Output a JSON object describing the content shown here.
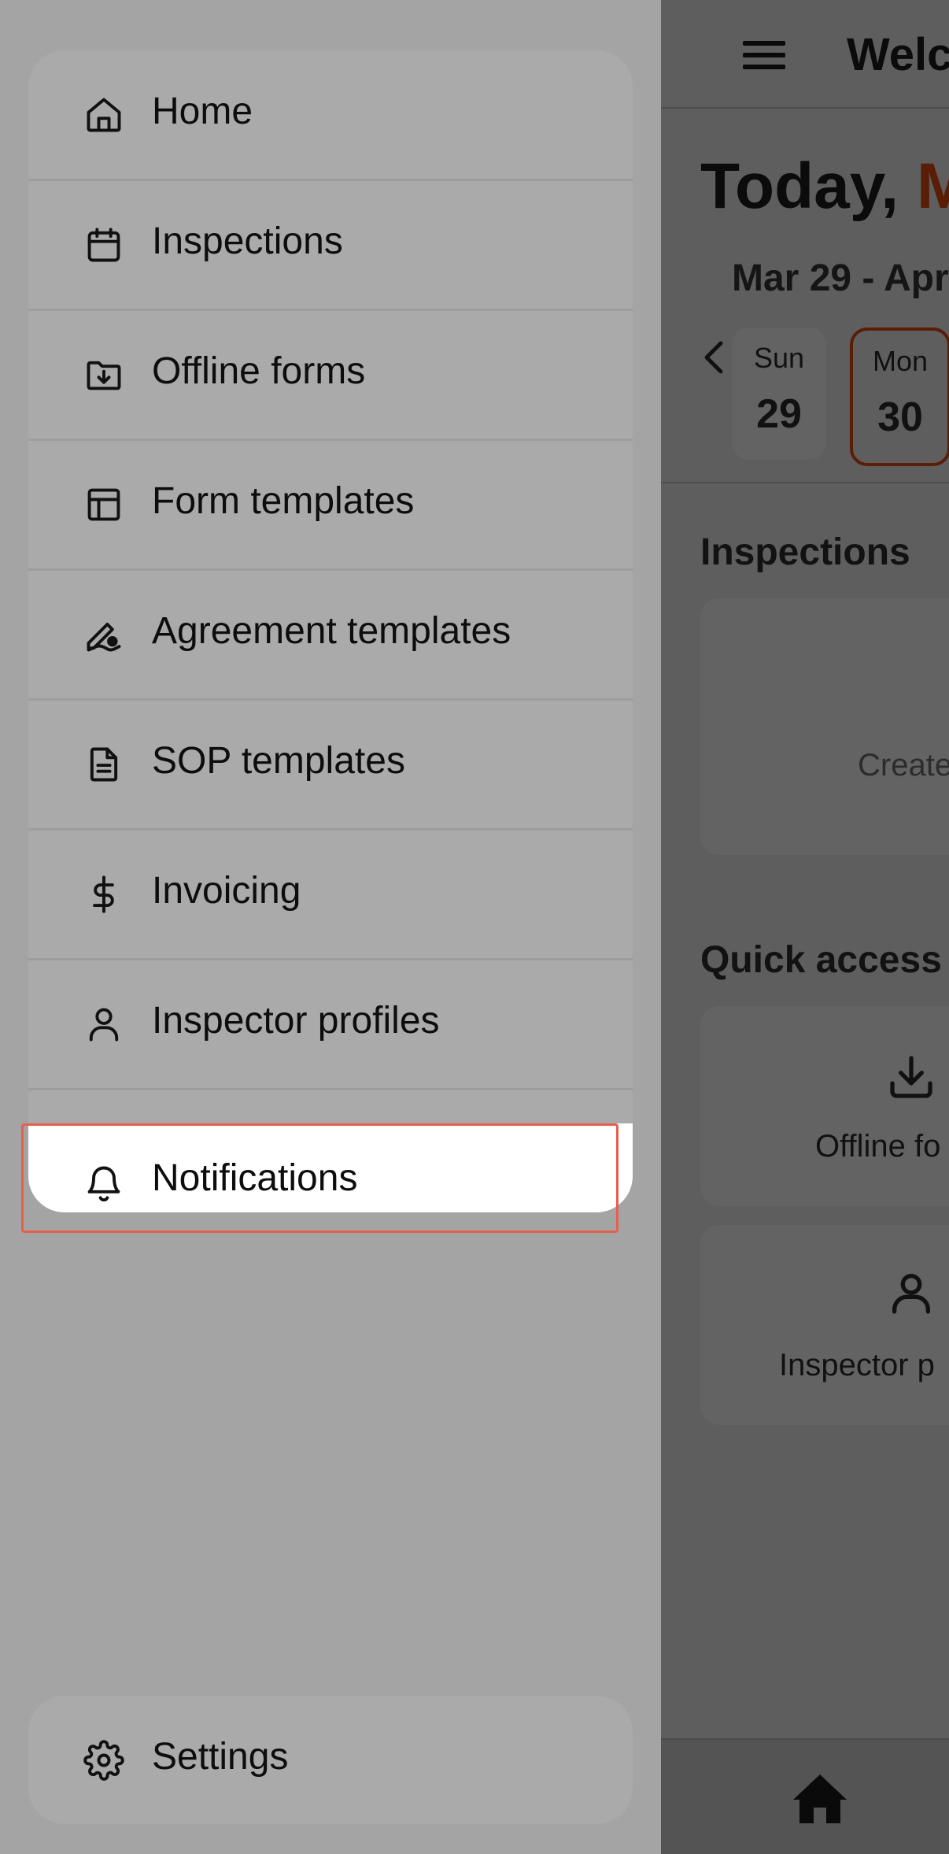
{
  "drawer": {
    "items": [
      {
        "label": "Home",
        "icon": "home-icon"
      },
      {
        "label": "Inspections",
        "icon": "calendar-icon"
      },
      {
        "label": "Offline forms",
        "icon": "folder-download-icon"
      },
      {
        "label": "Form templates",
        "icon": "layout-template-icon"
      },
      {
        "label": "Agreement templates",
        "icon": "signature-icon"
      },
      {
        "label": "SOP templates",
        "icon": "document-icon"
      },
      {
        "label": "Invoicing",
        "icon": "dollar-icon"
      },
      {
        "label": "Inspector profiles",
        "icon": "user-icon"
      },
      {
        "label": "Notifications",
        "icon": "bell-icon"
      }
    ],
    "highlighted": "Notifications",
    "settings": {
      "label": "Settings",
      "icon": "gear-icon"
    }
  },
  "app": {
    "title": "Welc",
    "today_prefix": "Today, ",
    "today_accent": "M",
    "date_range": "Mar 29 - Apr",
    "days": [
      {
        "dow": "Sun",
        "num": "29",
        "selected": false
      },
      {
        "dow": "Mon",
        "num": "30",
        "selected": true
      }
    ],
    "inspections_title": "Inspections",
    "inspections_empty": "Create",
    "quick_access_title": "Quick access",
    "quick_access": [
      {
        "label": "Offline fo",
        "icon": "download-icon"
      },
      {
        "label": "Inspector p",
        "icon": "user-icon"
      }
    ],
    "bottom_nav": {
      "icon": "home-icon"
    }
  },
  "colors": {
    "accent": "#5a1d06",
    "highlight_border": "#e5604a"
  }
}
